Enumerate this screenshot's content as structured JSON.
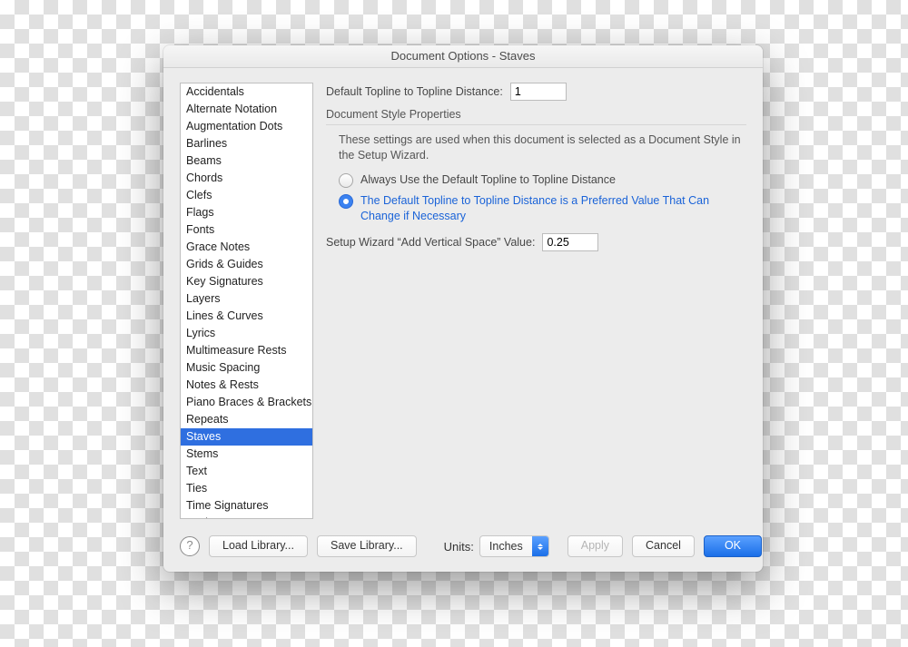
{
  "window": {
    "title": "Document Options - Staves"
  },
  "sidebar": {
    "items": [
      "Accidentals",
      "Alternate Notation",
      "Augmentation Dots",
      "Barlines",
      "Beams",
      "Chords",
      "Clefs",
      "Flags",
      "Fonts",
      "Grace Notes",
      "Grids & Guides",
      "Key Signatures",
      "Layers",
      "Lines & Curves",
      "Lyrics",
      "Multimeasure Rests",
      "Music Spacing",
      "Notes & Rests",
      "Piano Braces & Brackets",
      "Repeats",
      "Staves",
      "Stems",
      "Text",
      "Ties",
      "Time Signatures",
      "Tuplets"
    ],
    "selected_index": 20
  },
  "main": {
    "topline_label": "Default Topline to Topline Distance:",
    "topline_value": "1",
    "section_header": "Document Style Properties",
    "description": "These settings are used when this document is selected as a Document Style in the Setup Wizard.",
    "radio_options": {
      "always": "Always Use the Default Topline to Topline Distance",
      "preferred": "The Default Topline to Topline Distance is a Preferred Value That Can Change if Necessary"
    },
    "radio_selected": "preferred",
    "wizard_label": "Setup Wizard “Add Vertical Space” Value:",
    "wizard_value": "0.25"
  },
  "footer": {
    "help_glyph": "?",
    "load_library": "Load Library...",
    "save_library": "Save Library...",
    "units_label": "Units:",
    "units_value": "Inches",
    "apply": "Apply",
    "cancel": "Cancel",
    "ok": "OK"
  }
}
